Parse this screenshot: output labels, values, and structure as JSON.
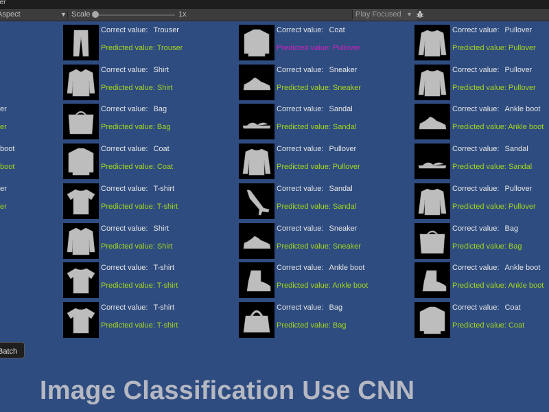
{
  "window": {
    "title_fragment": "her"
  },
  "toolbar": {
    "aspect_label": "Aspect",
    "scale_label": "Scale",
    "scale_value": "1x",
    "play_focused_label": "Play Focused"
  },
  "labels": {
    "correct": "Correct value:",
    "predicted": "Predicted value:"
  },
  "grid": [
    {
      "correct": "Trouser",
      "predicted": "Trouser",
      "match": true,
      "image": "trouser"
    },
    {
      "correct": "Coat",
      "predicted": "Pullover",
      "match": false,
      "image": "coat"
    },
    {
      "correct": "Pullover",
      "predicted": "Pullover",
      "match": true,
      "image": "pullover"
    },
    {
      "correct": "Shirt",
      "predicted": "Shirt",
      "match": true,
      "image": "shirt"
    },
    {
      "correct": "Sneaker",
      "predicted": "Sneaker",
      "match": true,
      "image": "sneaker"
    },
    {
      "correct": "Pullover",
      "predicted": "Pullover",
      "match": true,
      "image": "pullover"
    },
    {
      "correct": "Bag",
      "predicted": "Bag",
      "match": true,
      "image": "bag"
    },
    {
      "correct": "Sandal",
      "predicted": "Sandal",
      "match": true,
      "image": "sandal"
    },
    {
      "correct": "Ankle boot",
      "predicted": "Ankle boot",
      "match": true,
      "image": "sneaker"
    },
    {
      "correct": "Coat",
      "predicted": "Coat",
      "match": true,
      "image": "coat"
    },
    {
      "correct": "Pullover",
      "predicted": "Pullover",
      "match": true,
      "image": "pullover"
    },
    {
      "correct": "Sandal",
      "predicted": "Sandal",
      "match": true,
      "image": "sandal"
    },
    {
      "correct": "T-shirt",
      "predicted": "T-shirt",
      "match": true,
      "image": "tshirt"
    },
    {
      "correct": "Sandal",
      "predicted": "Sandal",
      "match": true,
      "image": "heel"
    },
    {
      "correct": "Pullover",
      "predicted": "Pullover",
      "match": true,
      "image": "pullover"
    },
    {
      "correct": "Shirt",
      "predicted": "Shirt",
      "match": true,
      "image": "shirt"
    },
    {
      "correct": "Sneaker",
      "predicted": "Sneaker",
      "match": true,
      "image": "sneaker"
    },
    {
      "correct": "Bag",
      "predicted": "Bag",
      "match": true,
      "image": "bag"
    },
    {
      "correct": "T-shirt",
      "predicted": "T-shirt",
      "match": true,
      "image": "tshirt"
    },
    {
      "correct": "Ankle boot",
      "predicted": "Ankle boot",
      "match": true,
      "image": "boot"
    },
    {
      "correct": "Ankle boot",
      "predicted": "Ankle boot",
      "match": true,
      "image": "boot"
    },
    {
      "correct": "T-shirt",
      "predicted": "T-shirt",
      "match": true,
      "image": "tshirt"
    },
    {
      "correct": "Bag",
      "predicted": "Bag",
      "match": true,
      "image": "handbag"
    },
    {
      "correct": "Coat",
      "predicted": "Coat",
      "match": true,
      "image": "coat"
    }
  ],
  "left_fragments": [
    {
      "correct": "er",
      "predicted": "er"
    },
    {
      "correct": "boot",
      "predicted": "boot"
    },
    {
      "correct": "er",
      "predicted": "er"
    }
  ],
  "batch_button_label": "Batch",
  "footer_title": "Image Classification Use CNN"
}
